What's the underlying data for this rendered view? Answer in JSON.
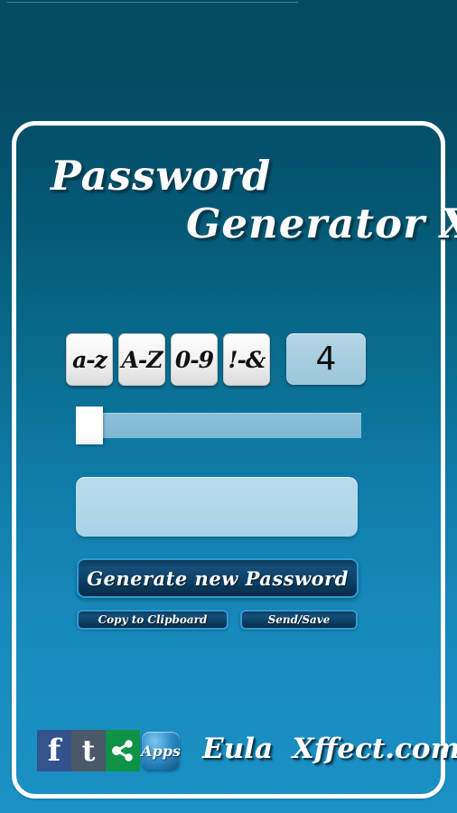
{
  "app": {
    "title_line_1": "Password",
    "title_line_2": "Generator X",
    "background_top_color": "#044a63",
    "background_bottom_color": "#1a90c4",
    "frame_color": "#ffffff"
  },
  "charset": {
    "buttons": [
      {
        "label": "a-z",
        "name": "lowercase"
      },
      {
        "label": "A-Z",
        "name": "uppercase"
      },
      {
        "label": "0-9",
        "name": "digits"
      },
      {
        "label": "!-&",
        "name": "symbols"
      }
    ]
  },
  "length": {
    "value": "4",
    "box_color": "#a6cddf"
  },
  "slider": {
    "position_percent": 0,
    "track_color": "#85bcd6",
    "thumb_color": "#ffffff"
  },
  "password": {
    "value": "",
    "placeholder": "",
    "field_color": "#b2d8e9"
  },
  "actions": {
    "generate_label": "Generate new Password",
    "copy_label": "Copy to Clipboard",
    "send_label": "Send/Save",
    "button_border_color": "#2f9ad6"
  },
  "footer": {
    "social": [
      {
        "name": "facebook-icon",
        "glyph": "f",
        "color": "#33528e"
      },
      {
        "name": "tumblr-icon",
        "glyph": "t",
        "color": "#4a5867"
      },
      {
        "name": "share-icon",
        "glyph": "",
        "color": "#0f9245"
      },
      {
        "name": "apps-icon",
        "glyph": "Apps",
        "color": "#2f8ecb"
      }
    ],
    "brand": "Eula  Xffect.com"
  }
}
